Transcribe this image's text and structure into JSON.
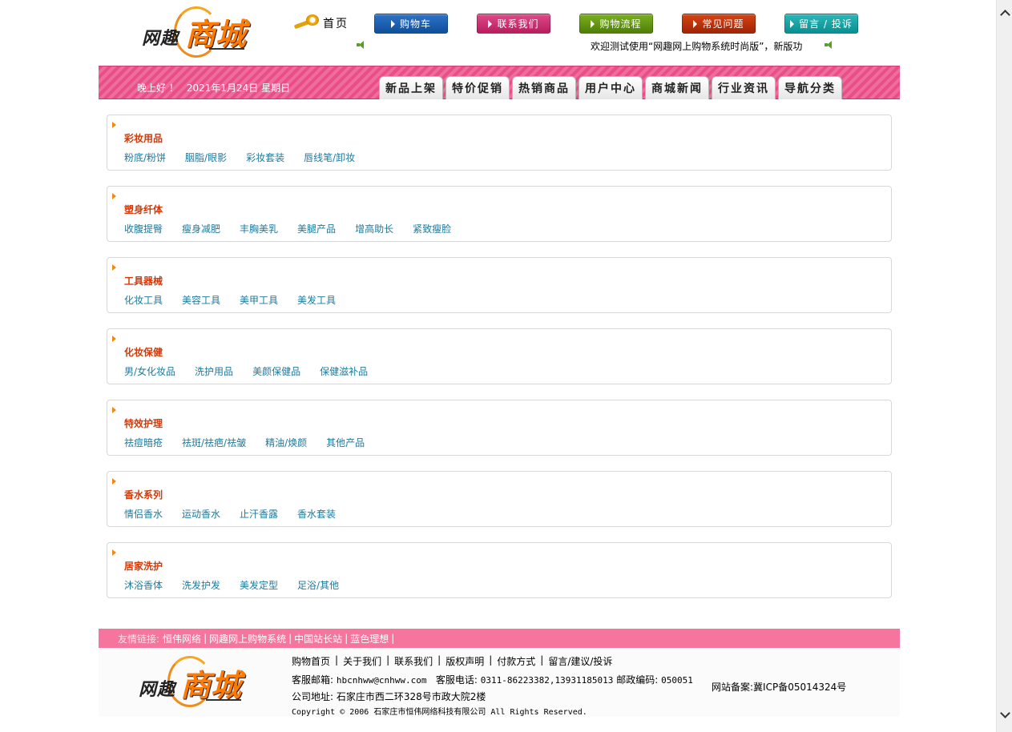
{
  "header": {
    "logo_text": "网趣",
    "logo_big": "商城",
    "home_label": "首页",
    "buttons": [
      "购物车",
      "联系我们",
      "购物流程",
      "常见问题",
      "留言 / 投诉"
    ],
    "marquee": "欢迎测试使用“网趣网上购物系统时尚版”，新版功"
  },
  "bar": {
    "greeting": "晚上好 ！",
    "date": "2021年1月24日 星期日",
    "tabs": [
      "新品上架",
      "特价促销",
      "热销商品",
      "用户中心",
      "商城新闻",
      "行业资讯",
      "导航分类"
    ]
  },
  "categories": [
    {
      "title": "彩妆用品",
      "links": [
        "粉底/粉饼",
        "胭脂/眼影",
        "彩妆套装",
        "唇线笔/卸妆"
      ]
    },
    {
      "title": "塑身纤体",
      "links": [
        "收腹提臀",
        "瘦身减肥",
        "丰胸美乳",
        "美腿产品",
        "增高助长",
        "紧致瘦脸"
      ]
    },
    {
      "title": "工具器械",
      "links": [
        "化妆工具",
        "美容工具",
        "美甲工具",
        "美发工具"
      ]
    },
    {
      "title": "化妆保健",
      "links": [
        "男/女化妆品",
        "洗护用品",
        "美颜保健品",
        "保健滋补品"
      ]
    },
    {
      "title": "特效护理",
      "links": [
        "祛痘暗疮",
        "祛斑/祛疤/祛皱",
        "精油/焕颜",
        "其他产品"
      ]
    },
    {
      "title": "香水系列",
      "links": [
        "情侣香水",
        "运动香水",
        "止汗香露",
        "香水套装"
      ]
    },
    {
      "title": "居家洗护",
      "links": [
        "沐浴香体",
        "洗发护发",
        "美发定型",
        "足浴/其他"
      ]
    }
  ],
  "footer": {
    "friend_label": "友情链接:",
    "friend_links": [
      "恒伟网络",
      "网趣网上购物系统",
      "中国站长站",
      "蓝色理想"
    ],
    "nav": [
      "购物首页",
      "关于我们",
      "联系我们",
      "版权声明",
      "付款方式",
      "留言/建议/投诉"
    ],
    "email_label": "客服邮箱:",
    "email": "hbcnhww@cnhww.com",
    "phone_label": "客服电话:",
    "phone": "0311-86223382,13931185013",
    "zip_label": "邮政编码:",
    "zip": "050051",
    "address": "公司地址: 石家庄市西二环328号市政大院2楼",
    "copyright": "Copyright © 2006 石家庄市恒伟网络科技有限公司 All Rights Reserved.",
    "icp": "网站备案:冀ICP备05014324号"
  },
  "colors": {
    "pink_bar": "#ef6d9c",
    "category_title": "#d23a0a",
    "category_link": "#1e7a9c",
    "footer_bar": "#f5759f"
  }
}
